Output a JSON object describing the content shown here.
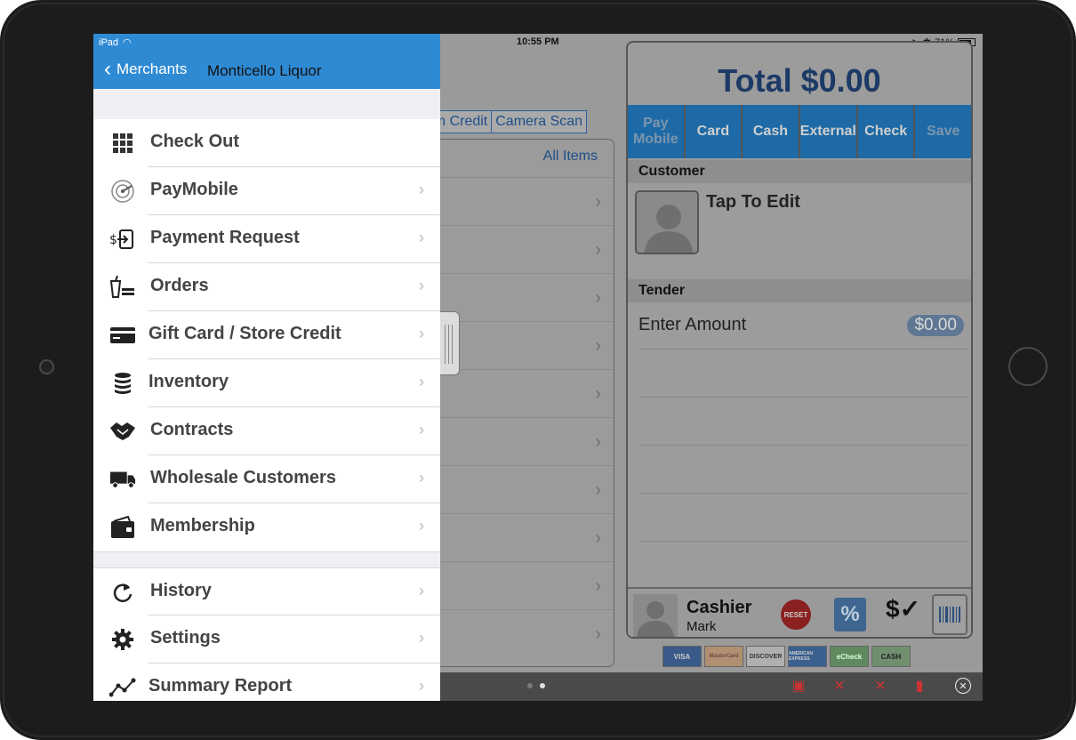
{
  "status": {
    "device": "iPad",
    "time": "10:55 PM",
    "battery": "71%"
  },
  "menu": {
    "back_label": "Merchants",
    "merchant": "Monticello Liquor",
    "items": [
      {
        "label": "Check Out",
        "icon": "grid-icon",
        "chevron": false
      },
      {
        "label": "PayMobile",
        "icon": "radar-icon",
        "chevron": true
      },
      {
        "label": "Payment Request",
        "icon": "payment-request-icon",
        "chevron": true
      },
      {
        "label": "Orders",
        "icon": "orders-icon",
        "chevron": true
      },
      {
        "label": "Gift Card / Store Credit",
        "icon": "credit-card-icon",
        "chevron": true
      },
      {
        "label": "Inventory",
        "icon": "database-icon",
        "chevron": true
      },
      {
        "label": "Contracts",
        "icon": "handshake-icon",
        "chevron": true
      },
      {
        "label": "Wholesale Customers",
        "icon": "truck-icon",
        "chevron": true
      },
      {
        "label": "Membership",
        "icon": "wallet-icon",
        "chevron": true
      }
    ],
    "items2": [
      {
        "label": "History",
        "icon": "refresh-icon",
        "chevron": true
      },
      {
        "label": "Settings",
        "icon": "gear-icon",
        "chevron": true
      },
      {
        "label": "Summary Report",
        "icon": "line-chart-icon",
        "chevron": true
      }
    ]
  },
  "toolbar": {
    "redeem_credit": "eem Credit",
    "camera_scan": "Camera Scan"
  },
  "items_panel": {
    "all_items": "All Items"
  },
  "order": {
    "total": "Total $0.00",
    "pay_buttons": [
      "Pay Mobile",
      "Card",
      "Cash",
      "External",
      "Check",
      "Save"
    ],
    "customer_header": "Customer",
    "tap_to_edit": "Tap To Edit",
    "tender_header": "Tender",
    "enter_amount": "Enter Amount",
    "amount": "$0.00",
    "cashier_title": "Cashier",
    "cashier_name": "Mark",
    "reset": "RESET",
    "discount": "%"
  },
  "payment_logos": [
    "VISA",
    "MasterCard",
    "DISCOVER",
    "AMERICAN EXPRESS",
    "eCheck",
    "CASH"
  ]
}
